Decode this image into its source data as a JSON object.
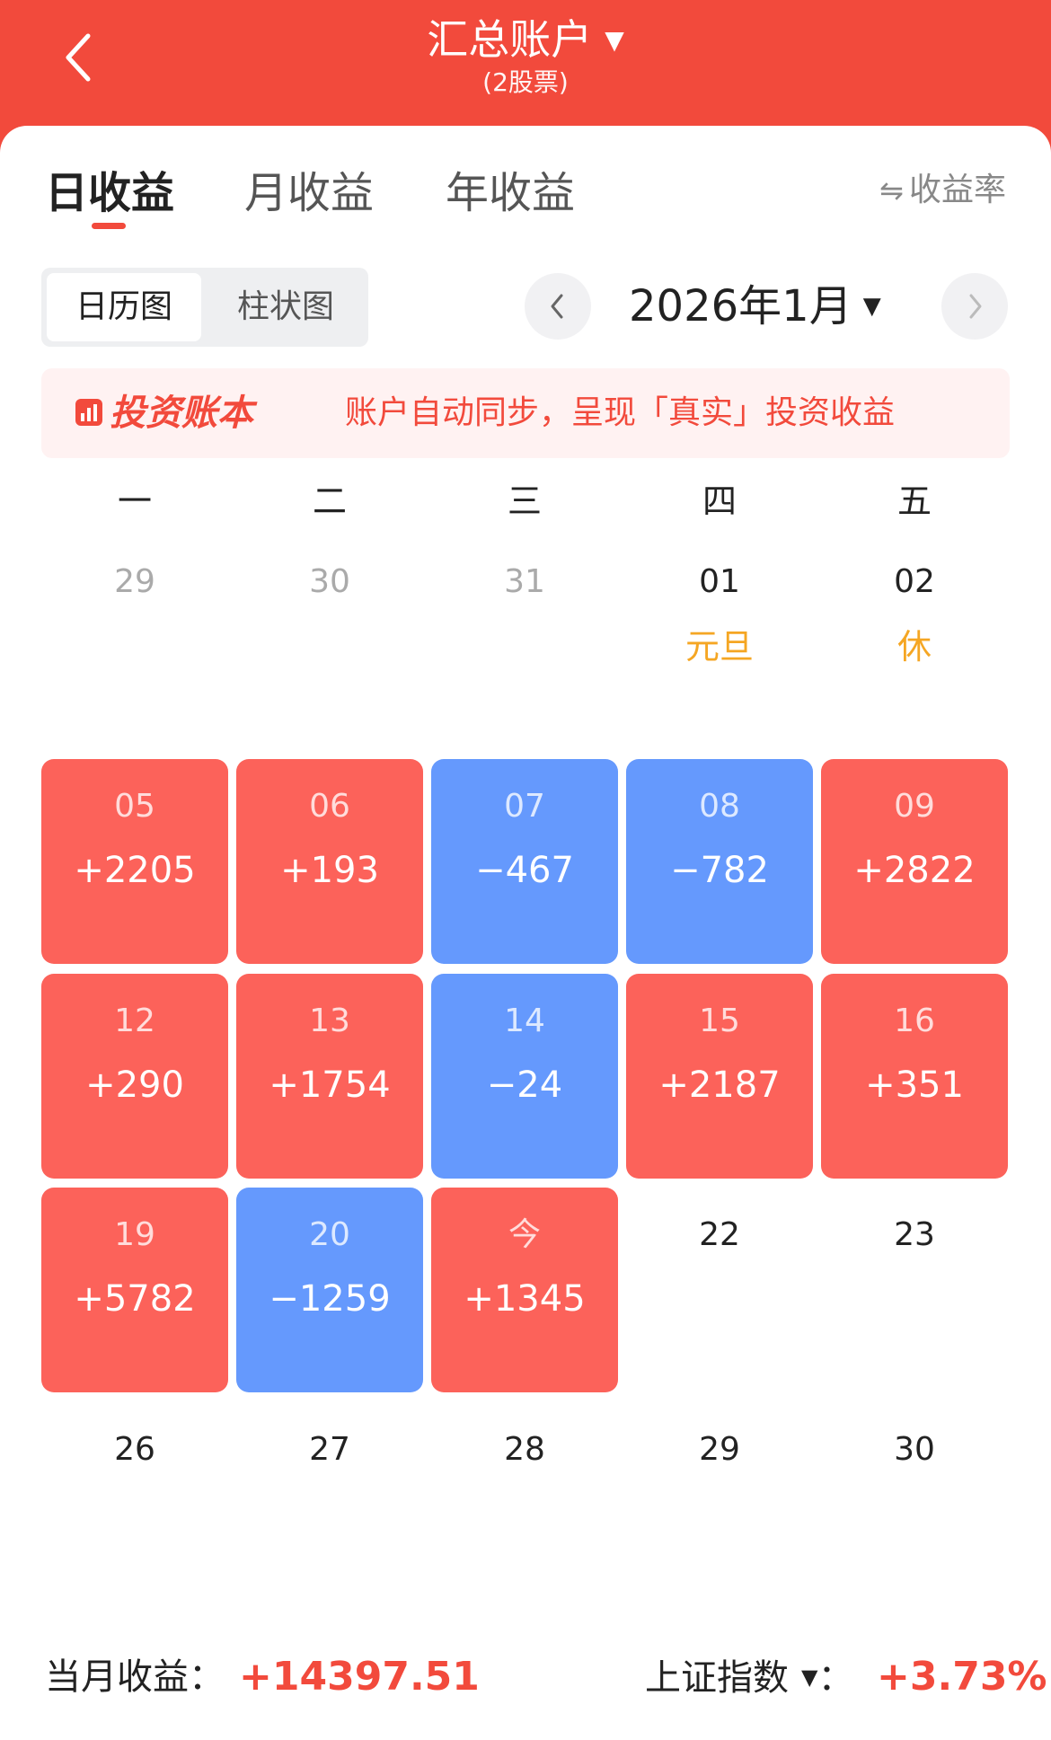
{
  "header": {
    "title": "汇总账户",
    "caret": "▼",
    "subtitle": "(2股票)"
  },
  "tabs": [
    {
      "label": "日收益",
      "active": true
    },
    {
      "label": "月收益",
      "active": false
    },
    {
      "label": "年收益",
      "active": false
    }
  ],
  "rate_toggle": {
    "icon": "⇋",
    "label": "收益率"
  },
  "view_toggle": {
    "options": [
      "日历图",
      "柱状图"
    ],
    "selected": "日历图"
  },
  "month_nav": {
    "label": "2026年1月",
    "caret": "▼"
  },
  "banner": {
    "logo": "投资账本",
    "text": "账户自动同步，呈现「真实」投资收益"
  },
  "weekdays": [
    "一",
    "二",
    "三",
    "四",
    "五"
  ],
  "calendar": {
    "weeks": [
      [
        {
          "day": "29",
          "muted": true
        },
        {
          "day": "30",
          "muted": true
        },
        {
          "day": "31",
          "muted": true
        },
        {
          "day": "01",
          "holiday": "元旦"
        },
        {
          "day": "02",
          "holiday": "休"
        }
      ],
      [
        {
          "day": "05",
          "value": "+2205",
          "trend": "up"
        },
        {
          "day": "06",
          "value": "+193",
          "trend": "up"
        },
        {
          "day": "07",
          "value": "−467",
          "trend": "down"
        },
        {
          "day": "08",
          "value": "−782",
          "trend": "down"
        },
        {
          "day": "09",
          "value": "+2822",
          "trend": "up"
        }
      ],
      [
        {
          "day": "12",
          "value": "+290",
          "trend": "up"
        },
        {
          "day": "13",
          "value": "+1754",
          "trend": "up"
        },
        {
          "day": "14",
          "value": "−24",
          "trend": "down"
        },
        {
          "day": "15",
          "value": "+2187",
          "trend": "up"
        },
        {
          "day": "16",
          "value": "+351",
          "trend": "up"
        }
      ],
      [
        {
          "day": "19",
          "value": "+5782",
          "trend": "up"
        },
        {
          "day": "20",
          "value": "−1259",
          "trend": "down"
        },
        {
          "day": "今",
          "value": "+1345",
          "trend": "up"
        },
        {
          "day": "22"
        },
        {
          "day": "23"
        }
      ],
      [
        {
          "day": "26"
        },
        {
          "day": "27"
        },
        {
          "day": "28"
        },
        {
          "day": "29"
        },
        {
          "day": "30"
        }
      ]
    ]
  },
  "footer": {
    "month_label": "当月收益：",
    "month_value": "+14397.51",
    "index_label": "上证指数",
    "index_caret": "▼",
    "index_colon": "：",
    "index_value": "+3.73%"
  },
  "colors": {
    "brand": "#f24a3c",
    "gain": "#fc625a",
    "loss": "#6599fd",
    "holiday": "#f5a623"
  }
}
